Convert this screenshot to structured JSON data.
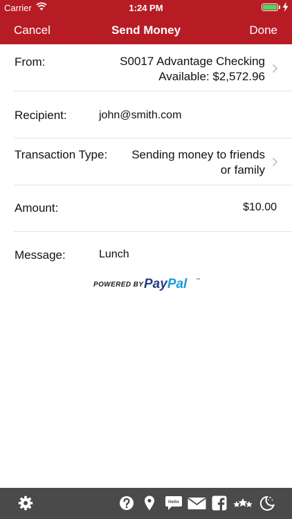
{
  "status_bar": {
    "carrier": "Carrier",
    "time": "1:24 PM",
    "battery_level": 1.0,
    "accent_battery": "#4cd964"
  },
  "nav": {
    "cancel": "Cancel",
    "title": "Send Money",
    "done": "Done",
    "color": "#b71c25"
  },
  "form": {
    "from": {
      "label": "From:",
      "account": "S0017 Advantage Checking",
      "available": "Available: $2,572.96"
    },
    "recipient": {
      "label": "Recipient:",
      "value": "john@smith.com"
    },
    "transaction_type": {
      "label": "Transaction Type:",
      "line1": "Sending money to friends",
      "line2": "or family"
    },
    "amount": {
      "label": "Amount:",
      "value": "$10.00"
    },
    "message": {
      "label": "Message:",
      "value": "Lunch"
    }
  },
  "paypal": {
    "powered_by": "POWERED BY",
    "pay": "Pay",
    "pal": "Pal",
    "tm": "™"
  },
  "toolbar": {
    "icons": [
      "gear-icon",
      "help-icon",
      "location-pin-icon",
      "chat-hello-icon",
      "mail-icon",
      "facebook-icon",
      "rating-stars-icon",
      "moon-icon"
    ],
    "hello_text": "Hello"
  }
}
